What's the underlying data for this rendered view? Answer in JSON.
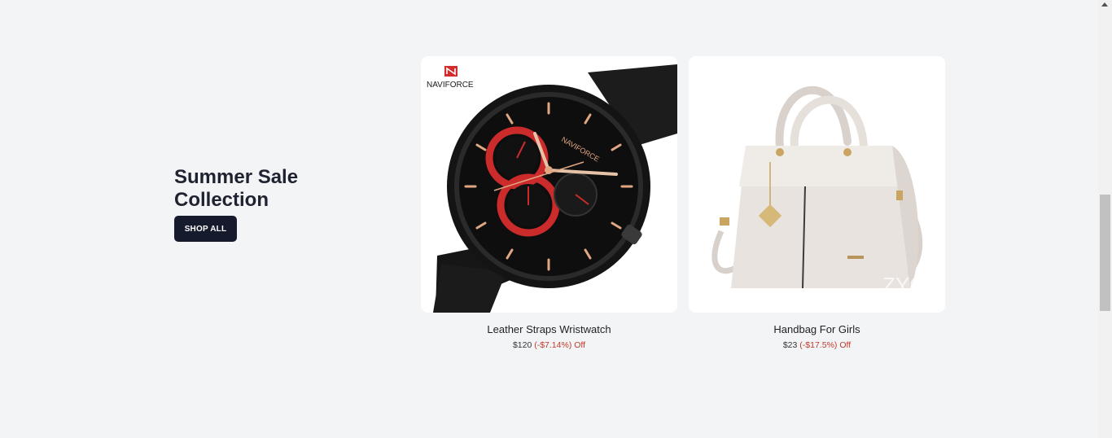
{
  "promo": {
    "title_line1": "Summer Sale",
    "title_line2": "Collection",
    "button_label": "SHOP ALL"
  },
  "products": [
    {
      "name": "Leather Straps Wristwatch",
      "price": "$120",
      "discount": "(-$7.14%) Off",
      "brand_mark": "NAVIFORCE",
      "image_icon": "wristwatch-icon"
    },
    {
      "name": "Handbag For Girls",
      "price": "$23",
      "discount": "(-$17.5%) Off",
      "watermark": "ZYG",
      "image_icon": "handbag-icon"
    }
  ],
  "colors": {
    "background": "#f3f4f6",
    "button": "#151a2d",
    "discount": "#c0392b",
    "title": "#1f2230"
  }
}
